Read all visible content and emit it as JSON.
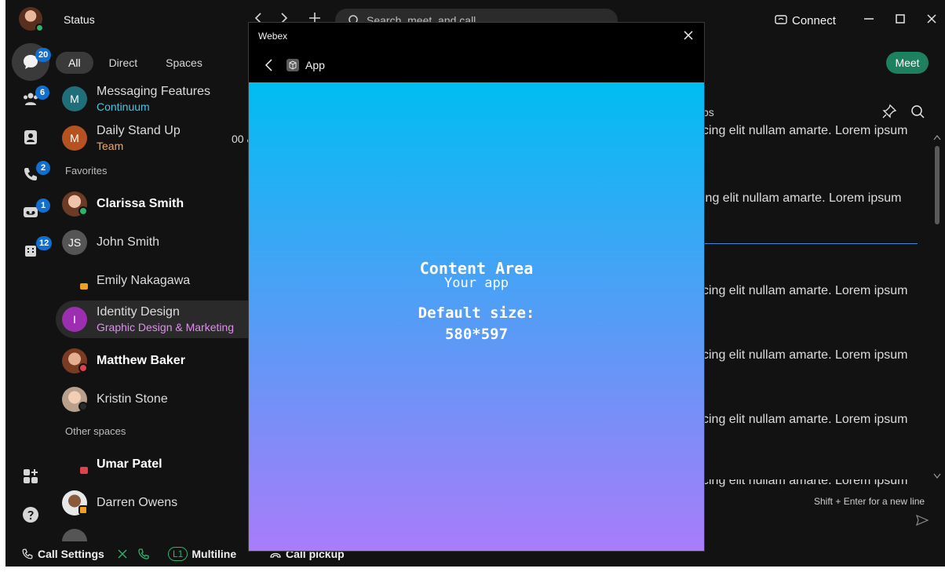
{
  "topbar": {
    "status_label": "Status",
    "search_placeholder": "Search, meet, and call",
    "connect_label": "Connect"
  },
  "rail": {
    "messaging_badge": "20",
    "teams_badge": "6",
    "calling_badge": "2",
    "voicemail_badge": "1",
    "apps_badge": "12"
  },
  "filters": {
    "all": "All",
    "direct": "Direct",
    "spaces": "Spaces"
  },
  "list": {
    "items": [
      {
        "initial": "M",
        "title": "Messaging Features",
        "subtitle": "Continuum",
        "sub_color": "#4fc3d9",
        "avatar_color": "#1f6f7a"
      },
      {
        "initial": "M",
        "title": "Daily Stand Up",
        "subtitle": "Team",
        "sub_color": "#f0a868",
        "avatar_color": "#b4531f"
      },
      {
        "title": "Clarissa Smith"
      },
      {
        "initial": "JS",
        "title": "John Smith"
      },
      {
        "title": "Emily Nakagawa"
      },
      {
        "initial": "I",
        "title": "Identity Design",
        "subtitle": "Graphic Design & Marketing",
        "sub_color": "#e08ef0",
        "avatar_color": "#9b2fb0"
      },
      {
        "title": "Matthew Baker"
      },
      {
        "title": "Kristin Stone"
      },
      {
        "title": "Umar Patel"
      },
      {
        "title": "Darren Owens"
      }
    ],
    "favorites_label": "Favorites",
    "other_spaces_label": "Other spaces",
    "partial_time": "00 &"
  },
  "right": {
    "meet_label": "Meet",
    "tab_fragment": "ps",
    "messages": [
      "scing elit nullam amarte. Lorem ipsum",
      "cing elit nullam amarte. Lorem ipsum",
      "scing elit nullam amarte. Lorem ipsum",
      "scing elit nullam amarte. Lorem ipsum",
      "scing elit nullam amarte. Lorem ipsum",
      "scing elit nullam amarte. Lorem ipsum"
    ],
    "hint": "Shift + Enter for a new line"
  },
  "bottombar": {
    "call_settings": "Call Settings",
    "line_tag": "L1",
    "multiline": "Multiline",
    "call_pickup": "Call pickup"
  },
  "modal": {
    "window_title": "Webex",
    "app_name": "App",
    "content_title": "Content Area",
    "content_subtitle": "Your app",
    "size_label": "Default size:",
    "size_value": "580*597"
  },
  "colors": {
    "accent_blue": "#1170cf",
    "meet_green": "#1d8160",
    "gradient_top": "#00bdf2",
    "gradient_bottom": "#a97cfa"
  }
}
